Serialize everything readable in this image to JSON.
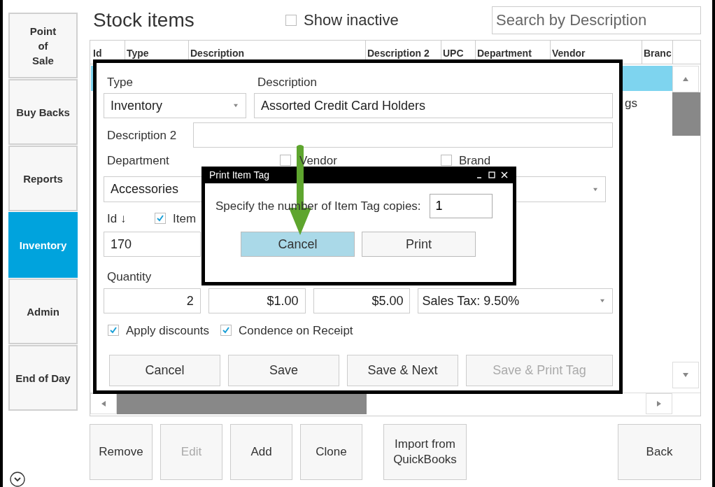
{
  "sidebar": {
    "items": [
      {
        "label": "Point\nof\nSale",
        "selected": false
      },
      {
        "label": "Buy Backs",
        "selected": false
      },
      {
        "label": "Reports",
        "selected": false
      },
      {
        "label": "Inventory",
        "selected": true
      },
      {
        "label": "Admin",
        "selected": false
      },
      {
        "label": "End of Day",
        "selected": false
      }
    ]
  },
  "title": "Stock items",
  "show_inactive": {
    "label": "Show inactive",
    "checked": false
  },
  "search": {
    "placeholder": "Search by Description"
  },
  "table": {
    "columns": [
      "Id",
      "Type",
      "Description",
      "Description 2",
      "UPC",
      "Department",
      "Vendor",
      "Branc"
    ],
    "rows": [
      {
        "selected": true
      },
      {
        "selected": false,
        "vendor": "gs"
      }
    ]
  },
  "item_dialog": {
    "type": {
      "label": "Type",
      "value": "Inventory"
    },
    "description": {
      "label": "Description",
      "value": "Assorted Credit Card Holders"
    },
    "description_2": {
      "label": "Description 2"
    },
    "department": {
      "label": "Department",
      "value": "Accessories"
    },
    "vendor": {
      "label": "Vendor",
      "checked": false
    },
    "brand": {
      "label": "Brand",
      "checked": false
    },
    "id": {
      "label": "Id ↓",
      "value": "170"
    },
    "item": {
      "label": "Item",
      "checked": true
    },
    "quantity": {
      "label": "Quantity",
      "value": "2"
    },
    "cost": "$1.00",
    "price": "$5.00",
    "tax": "Sales Tax: 9.50%",
    "options": [
      {
        "label": "Apply discounts",
        "checked": true
      },
      {
        "label": "Condence on Receipt",
        "checked": true
      }
    ],
    "buttons": [
      {
        "label": "Cancel",
        "disabled": false
      },
      {
        "label": "Save",
        "disabled": false
      },
      {
        "label": "Save & Next",
        "disabled": false
      },
      {
        "label": "Save & Print Tag",
        "disabled": true
      }
    ]
  },
  "print_dialog": {
    "title": "Print Item Tag",
    "prompt": "Specify the number of Item Tag copies:",
    "copies": "1",
    "buttons": [
      {
        "label": "Cancel",
        "selected": true
      },
      {
        "label": "Print",
        "selected": false
      }
    ]
  },
  "buttons": [
    {
      "label": "Remove",
      "disabled": false
    },
    {
      "label": "Edit",
      "disabled": true
    },
    {
      "label": "Add",
      "disabled": false
    },
    {
      "label": "Clone",
      "disabled": false
    },
    {
      "label": "Import from\nQuickBooks",
      "disabled": false
    },
    {
      "label": "Back",
      "disabled": false
    }
  ]
}
